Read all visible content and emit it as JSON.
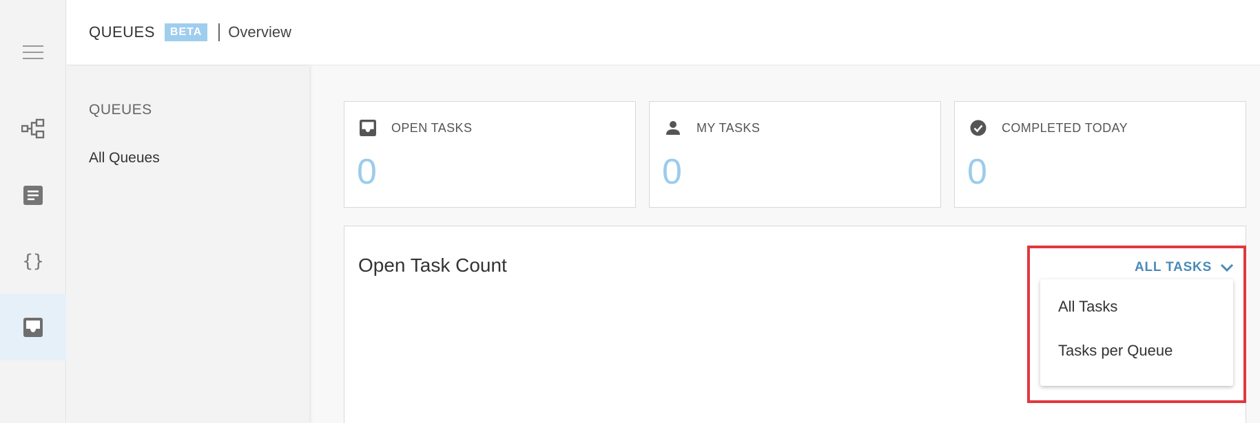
{
  "header": {
    "app_title": "QUEUES",
    "badge": "BETA",
    "breadcrumb": "Overview"
  },
  "rail": {
    "icons": [
      "menu-icon",
      "process-diagram-icon",
      "document-icon",
      "code-braces-icon",
      "inbox-icon"
    ],
    "active": "inbox-icon"
  },
  "sidebar": {
    "heading": "QUEUES",
    "items": [
      {
        "label": "All Queues"
      }
    ]
  },
  "stats": [
    {
      "label": "OPEN TASKS",
      "value": "0",
      "icon": "inbox-icon"
    },
    {
      "label": "MY TASKS",
      "value": "0",
      "icon": "person-icon"
    },
    {
      "label": "COMPLETED TODAY",
      "value": "0",
      "icon": "check-circle-icon"
    }
  ],
  "panel": {
    "title": "Open Task Count",
    "dropdown": {
      "selected": "ALL TASKS",
      "options": [
        "All Tasks",
        "Tasks per Queue"
      ]
    }
  },
  "colors": {
    "accent": "#4a8ab8",
    "value": "#9ccbec",
    "badge": "#9fcdee",
    "highlight": "#e0383d",
    "rail_active": "#e6f0f8"
  }
}
